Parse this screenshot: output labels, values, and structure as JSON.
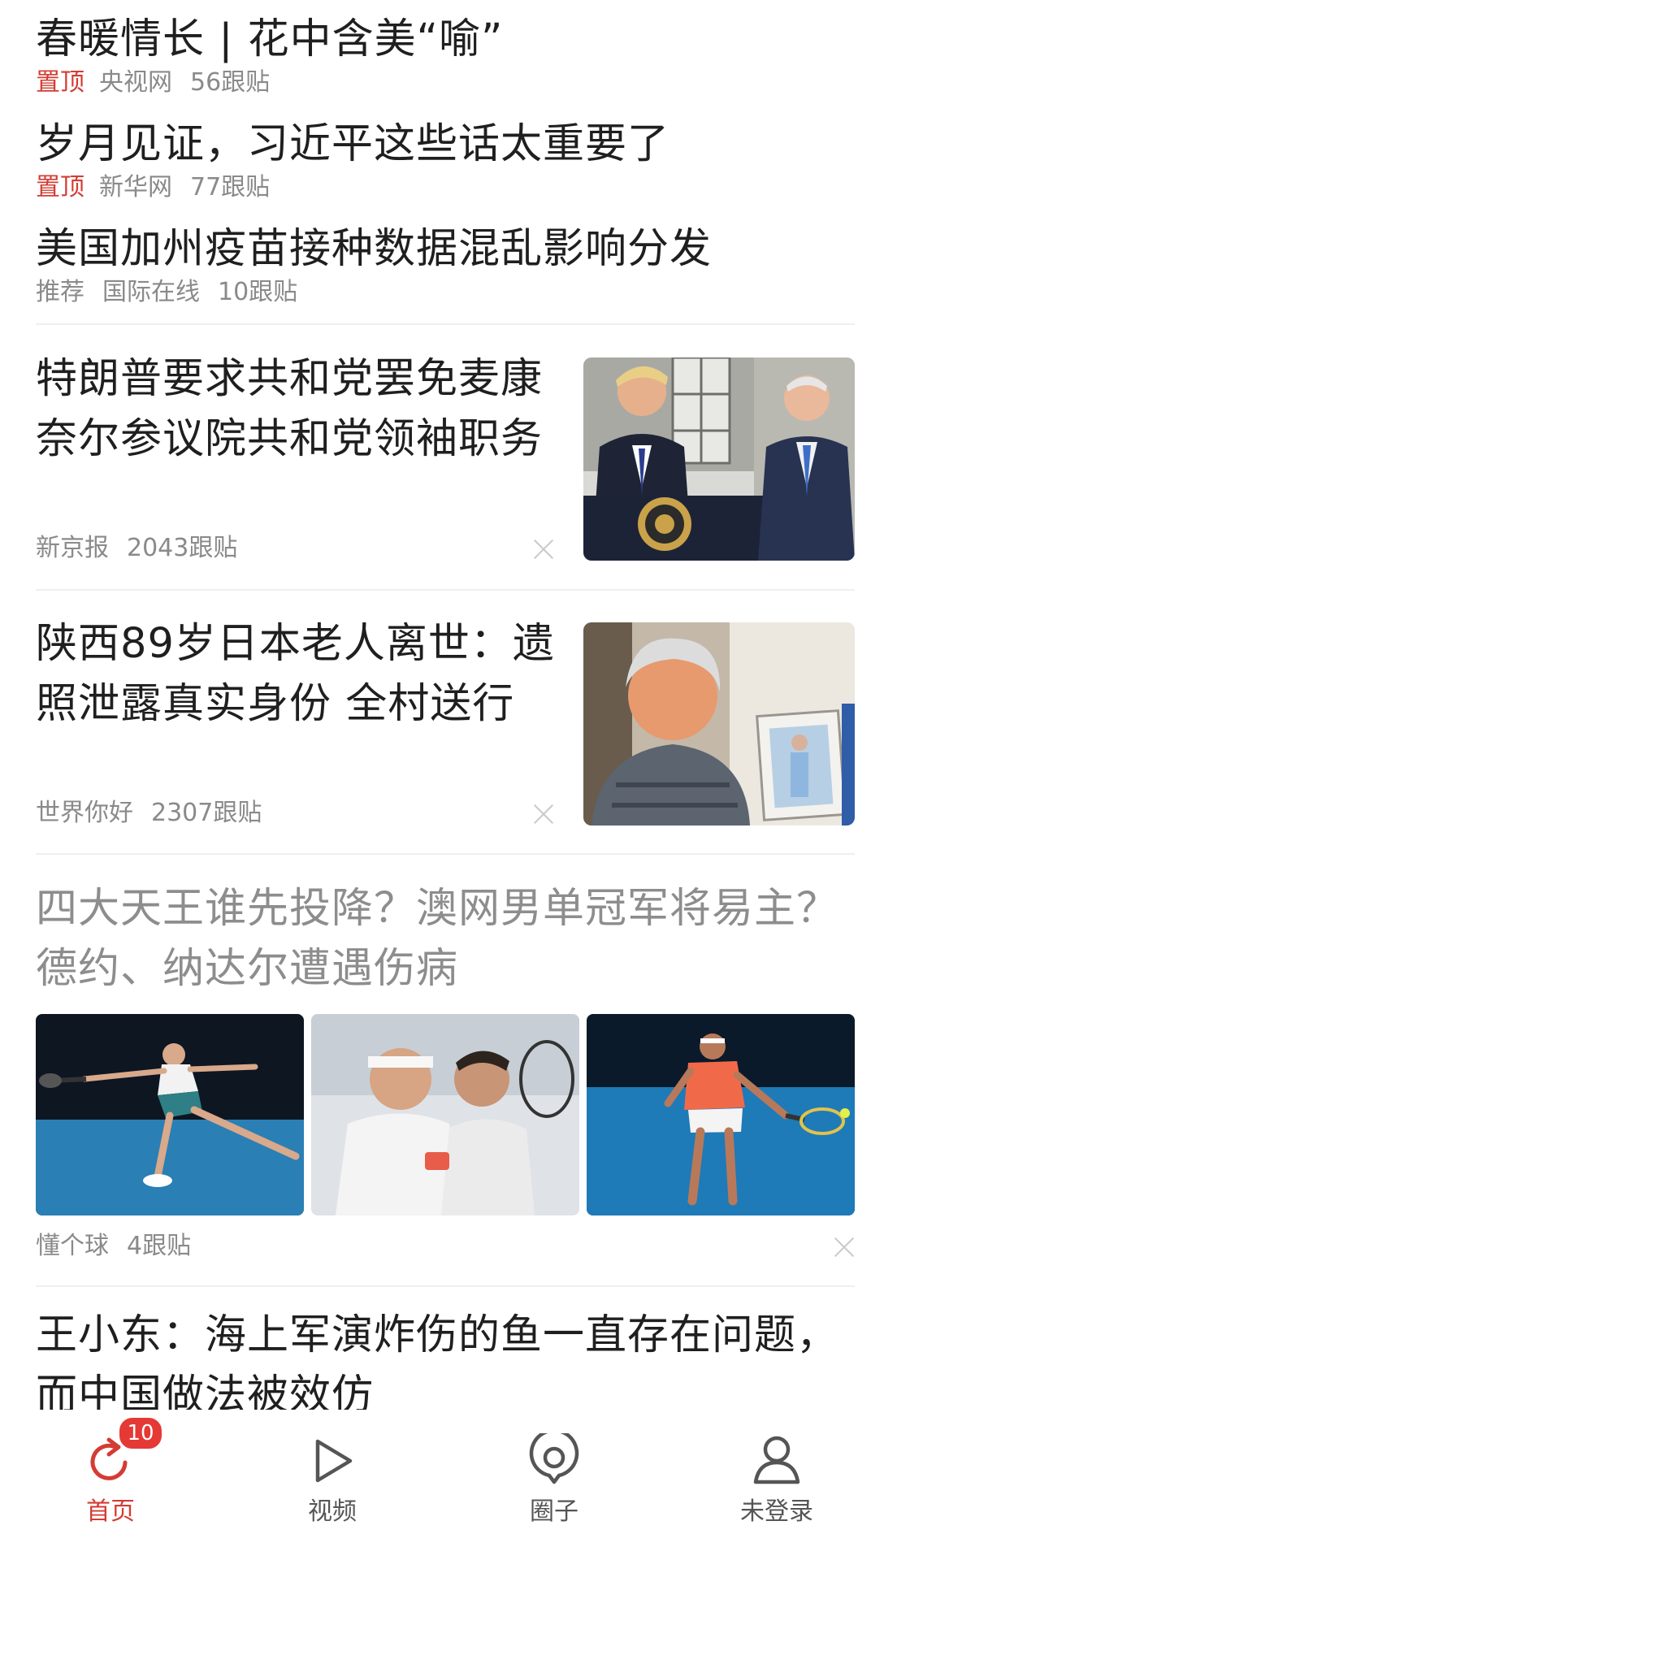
{
  "news": [
    {
      "title": "春暖情长 | 花中含美“喻”",
      "tag": "置顶",
      "source": "央视网",
      "comments": "56跟贴"
    },
    {
      "title": "岁月见证，习近平这些话太重要了",
      "tag": "置顶",
      "source": "新华网",
      "comments": "77跟贴"
    },
    {
      "title": "美国加州疫苗接种数据混乱影响分发",
      "tag": "推荐",
      "source": "国际在线",
      "comments": "10跟贴"
    }
  ],
  "article1": {
    "line1": "特朗普要求共和党罢免麦康",
    "line2": "奈尔参议院共和党领袖职务",
    "source": "新京报",
    "comments": "2043跟贴",
    "image": "trump-mcconnell-photo"
  },
  "article2": {
    "line1": "陕西89岁日本老人离世：遗",
    "line2": "照泄露真实身份 全村送行",
    "source": "世界你好",
    "comments": "2307跟贴",
    "image": "elderly-woman-photo"
  },
  "article3": {
    "line1": "四大天王谁先投降？澳网男单冠军将易主？",
    "line2": "德约、纳达尔遭遇伤病",
    "source": "懂个球",
    "comments": "4跟贴",
    "images": [
      "djokovic-photo",
      "players-photo",
      "nadal-photo"
    ]
  },
  "article4": {
    "line1": "王小东：海上军演炸伤的鱼一直存在问题，",
    "line2": "而中国做法被效仿"
  },
  "tabbar": {
    "home": {
      "label": "首页",
      "badge": "10",
      "icon": "refresh-icon"
    },
    "video": {
      "label": "视频",
      "icon": "play-icon"
    },
    "circle": {
      "label": "圈子",
      "icon": "circle-pin-icon"
    },
    "profile": {
      "label": "未登录",
      "icon": "user-icon"
    }
  },
  "colors": {
    "accent": "#d43c33",
    "badge": "#e53935",
    "meta": "#8a8a8a"
  }
}
